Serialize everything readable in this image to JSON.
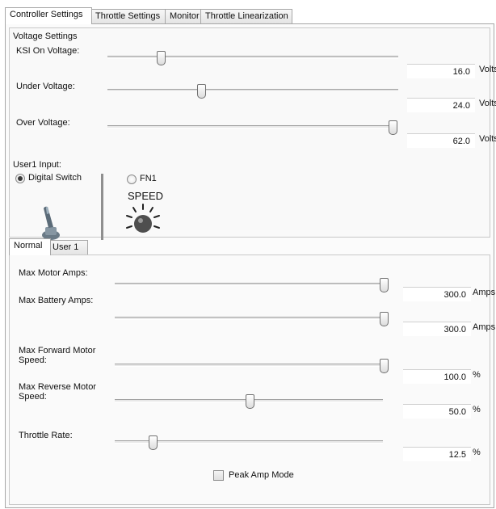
{
  "main_tabs": [
    {
      "label": "Controller Settings",
      "active": true
    },
    {
      "label": "Throttle Settings",
      "active": false
    },
    {
      "label": "Monitor",
      "active": false
    },
    {
      "label": "Throttle Linearization",
      "active": false
    }
  ],
  "voltage": {
    "group_title": "Voltage Settings",
    "ksi": {
      "label": "KSI On Voltage:",
      "value": "16.0",
      "unit": "Volts",
      "level": 0.18
    },
    "under": {
      "label": "Under Voltage:",
      "value": "24.0",
      "unit": "Volts",
      "level": 0.32
    },
    "over": {
      "label": "Over Voltage:",
      "value": "62.0",
      "unit": "Volts",
      "level": 1.0
    }
  },
  "user1_input": {
    "label": "User1 Input:",
    "digital_switch_label": "Digital Switch",
    "digital_switch_selected": true,
    "fn1_label": "FN1",
    "fn1_selected": false,
    "speed_label": "SPEED",
    "toggle_icon": "toggle-switch-icon",
    "speed_icon": "speed-light-icon"
  },
  "sub_tabs": [
    {
      "label": "Normal",
      "active": true
    },
    {
      "label": "User 1",
      "active": false
    }
  ],
  "motor": {
    "max_motor_amps": {
      "label": "Max Motor Amps:",
      "value": "300.0",
      "unit": "Amps",
      "level": 1.0
    },
    "max_battery_amps": {
      "label": "Max Battery Amps:",
      "value": "300.0",
      "unit": "Amps",
      "level": 1.0
    },
    "max_forward_speed": {
      "label": "Max Forward Motor Speed:",
      "value": "100.0",
      "unit": "%",
      "level": 1.0
    },
    "max_reverse_speed": {
      "label": "Max Reverse Motor Speed:",
      "value": "50.0",
      "unit": "%",
      "level": 0.5
    },
    "throttle_rate": {
      "label": "Throttle Rate:",
      "value": "12.5",
      "unit": "%",
      "level": 0.14
    },
    "peak_amp_mode_label": "Peak Amp Mode",
    "peak_amp_mode_checked": false
  }
}
